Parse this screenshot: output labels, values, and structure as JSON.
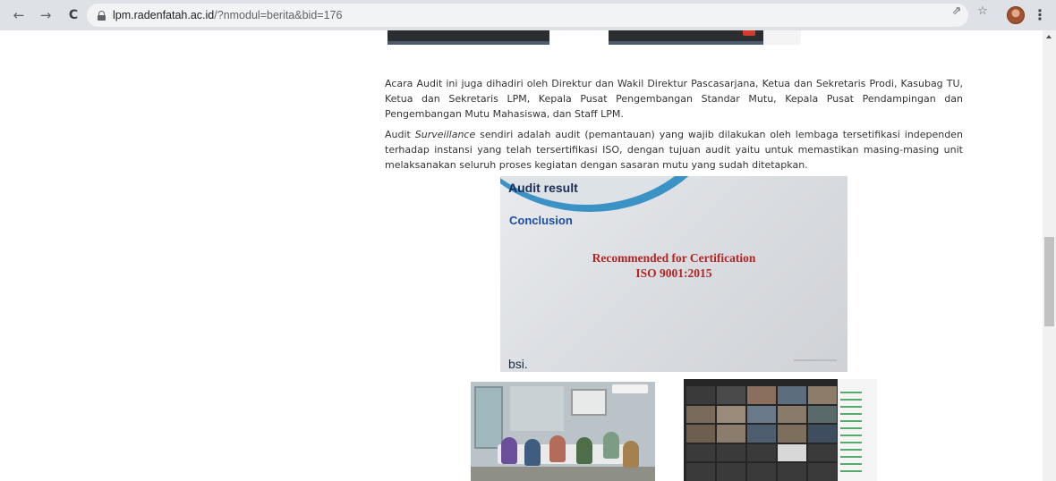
{
  "browser": {
    "url_host": "lpm.radenfatah.ac.id",
    "url_path": "/?nmodul=berita&bid=176",
    "icons": [
      "back-arrow-icon",
      "forward-arrow-icon",
      "reload-icon",
      "lock-icon",
      "share-icon",
      "star-icon",
      "avatar",
      "kebab-menu-icon"
    ]
  },
  "article": {
    "paragraph1": "Acara Audit ini juga dihadiri oleh Direktur dan Wakil Direktur Pascasarjana, Ketua dan Sekretaris Prodi, Kasubag TU, Ketua dan Sekretaris LPM, Kepala Pusat Pengembangan Standar Mutu, Kepala Pusat Pendampingan dan Pengembangan Mutu Mahasiswa, dan Staff LPM.",
    "paragraph2_lead": "Audit ",
    "paragraph2_italic": "Surveillance",
    "paragraph2_rest": " sendiri adalah audit (pemantauan) yang wajib dilakukan oleh lembaga tersetifikasi independen terhadap instansi yang telah tersertifikasi ISO, dengan tujuan audit yaitu untuk memastikan masing-masing unit melaksanakan seluruh proses kegiatan dengan sasaran mutu yang sudah ditetapkan.",
    "hero_slide": {
      "heading": "Audit result",
      "subheading": "Conclusion",
      "line1": "Recommended for Certification",
      "line2": "ISO 9001:2015",
      "brand": "bsi."
    }
  },
  "colors": {
    "accent_blue": "#3b92c4",
    "slide_red": "#b32424",
    "text": "#333333"
  }
}
